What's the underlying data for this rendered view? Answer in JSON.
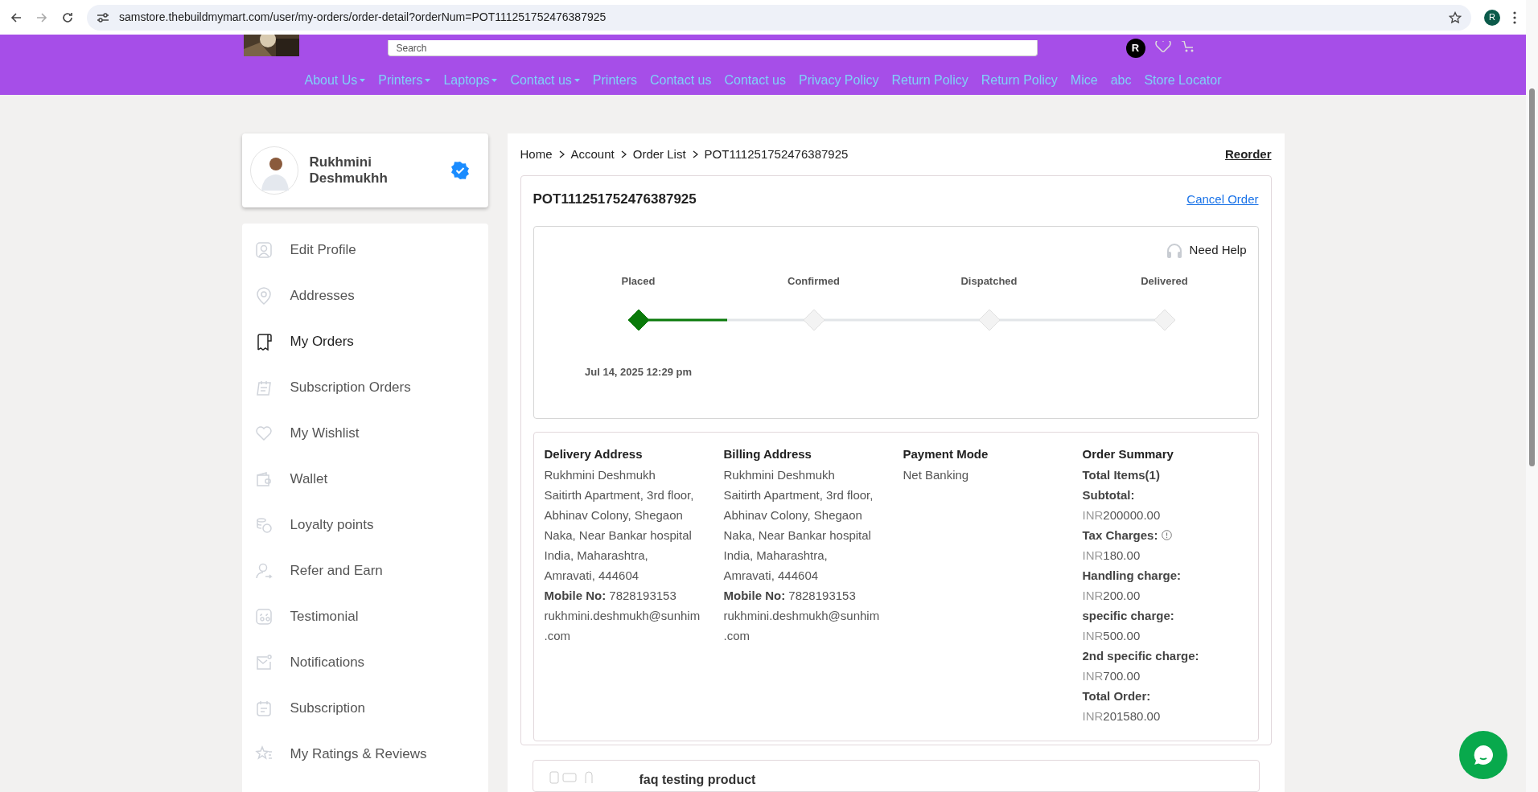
{
  "browser": {
    "url": "samstore.thebuildmymart.com/user/my-orders/order-detail?orderNum=POT111251752476387925",
    "profile_initial": "R"
  },
  "header": {
    "search_placeholder": "Search",
    "account_initial": "R",
    "nav": [
      {
        "label": "About Us",
        "dropdown": true
      },
      {
        "label": "Printers",
        "dropdown": true
      },
      {
        "label": "Laptops",
        "dropdown": true
      },
      {
        "label": "Contact us",
        "dropdown": true
      },
      {
        "label": "Printers",
        "dropdown": false
      },
      {
        "label": "Contact us",
        "dropdown": false
      },
      {
        "label": "Contact us",
        "dropdown": false
      },
      {
        "label": "Privacy Policy",
        "dropdown": false
      },
      {
        "label": "Return Policy",
        "dropdown": false
      },
      {
        "label": "Return Policy",
        "dropdown": false
      },
      {
        "label": "Mice",
        "dropdown": false
      },
      {
        "label": "abc",
        "dropdown": false
      },
      {
        "label": "Store Locator",
        "dropdown": false
      }
    ]
  },
  "profile": {
    "name": "Rukhmini Deshmukhh",
    "verified": true
  },
  "sidebar": {
    "items": [
      {
        "label": "Edit Profile",
        "selected": false
      },
      {
        "label": "Addresses",
        "selected": false
      },
      {
        "label": "My Orders",
        "selected": true
      },
      {
        "label": "Subscription Orders",
        "selected": false
      },
      {
        "label": "My Wishlist",
        "selected": false
      },
      {
        "label": "Wallet",
        "selected": false
      },
      {
        "label": "Loyalty points",
        "selected": false
      },
      {
        "label": "Refer and Earn",
        "selected": false
      },
      {
        "label": "Testimonial",
        "selected": false
      },
      {
        "label": "Notifications",
        "selected": false
      },
      {
        "label": "Subscription",
        "selected": false
      },
      {
        "label": "My Ratings & Reviews",
        "selected": false
      }
    ]
  },
  "breadcrumb": [
    "Home",
    "Account",
    "Order List",
    "POT111251752476387925"
  ],
  "reorder": "Reorder",
  "order": {
    "number": "POT111251752476387925",
    "cancel": "Cancel Order",
    "need_help": "Need Help",
    "steps": [
      {
        "label": "Placed",
        "reached": true,
        "date": "Jul 14, 2025 12:29 pm"
      },
      {
        "label": "Confirmed",
        "reached": false
      },
      {
        "label": "Dispatched",
        "reached": false
      },
      {
        "label": "Delivered",
        "reached": false
      }
    ]
  },
  "details": [
    {
      "kind": "address",
      "title": "Delivery Address",
      "lines": [
        "Rukhmini Deshmukh",
        "Saitirth Apartment, 3rd floor, Abhinav Colony, Shegaon Naka, Near Bankar hospital",
        "India, Maharashtra, Amravati, 444604",
        "**Mobile No:** 7828193153",
        "rukhmini.deshmukh@sunhim.com"
      ]
    },
    {
      "kind": "address",
      "title": "Billing Address",
      "lines": [
        "Rukhmini Deshmukh",
        "Saitirth Apartment, 3rd floor, Abhinav Colony, Shegaon Naka, Near Bankar hospital",
        "India, Maharashtra, Amravati, 444604",
        "**Mobile No:** 7828193153",
        "rukhmini.deshmukh@sunhim.com"
      ]
    },
    {
      "kind": "payment",
      "title": "Payment Mode",
      "lines": [
        "Net Banking"
      ]
    },
    {
      "kind": "summary",
      "title": "Order Summary",
      "total_items": "Total Items(1)",
      "rows": [
        {
          "label": "Subtotal:",
          "currency": "INR",
          "amount": "200000.00",
          "info": false
        },
        {
          "label": "Tax Charges:",
          "currency": "INR",
          "amount": "180.00",
          "info": true
        },
        {
          "label": "Handling charge:",
          "currency": "INR",
          "amount": "200.00",
          "info": false
        },
        {
          "label": "specific charge:",
          "currency": "INR",
          "amount": "500.00",
          "info": false
        },
        {
          "label": "2nd specific charge:",
          "currency": "INR",
          "amount": "700.00",
          "info": false
        },
        {
          "label": "Total Order:",
          "currency": "INR",
          "amount": "201580.00",
          "info": false
        }
      ]
    }
  ],
  "product": {
    "name": "faq testing product"
  }
}
